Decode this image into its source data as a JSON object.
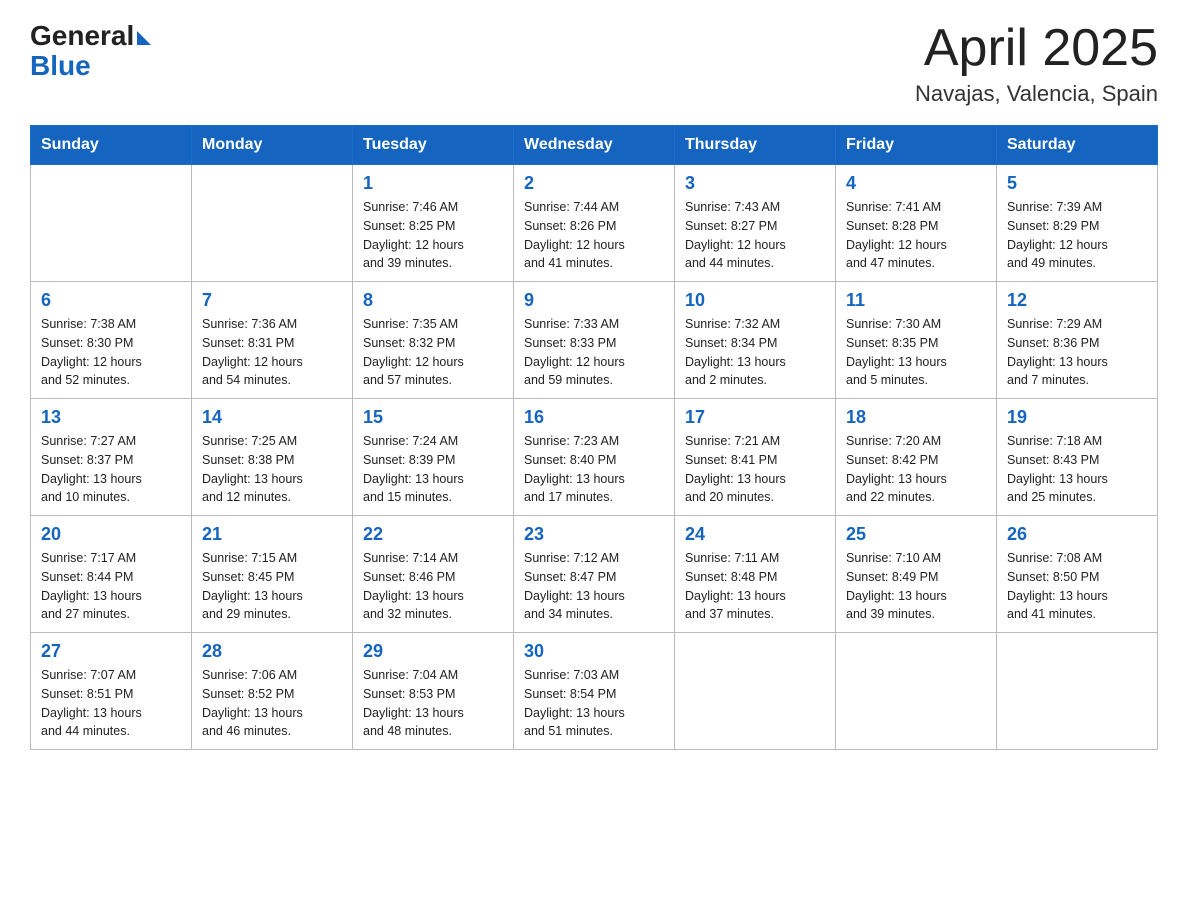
{
  "header": {
    "logo_general": "General",
    "logo_blue": "Blue",
    "title": "April 2025",
    "subtitle": "Navajas, Valencia, Spain"
  },
  "weekdays": [
    "Sunday",
    "Monday",
    "Tuesday",
    "Wednesday",
    "Thursday",
    "Friday",
    "Saturday"
  ],
  "weeks": [
    [
      {
        "day": "",
        "info": ""
      },
      {
        "day": "",
        "info": ""
      },
      {
        "day": "1",
        "info": "Sunrise: 7:46 AM\nSunset: 8:25 PM\nDaylight: 12 hours\nand 39 minutes."
      },
      {
        "day": "2",
        "info": "Sunrise: 7:44 AM\nSunset: 8:26 PM\nDaylight: 12 hours\nand 41 minutes."
      },
      {
        "day": "3",
        "info": "Sunrise: 7:43 AM\nSunset: 8:27 PM\nDaylight: 12 hours\nand 44 minutes."
      },
      {
        "day": "4",
        "info": "Sunrise: 7:41 AM\nSunset: 8:28 PM\nDaylight: 12 hours\nand 47 minutes."
      },
      {
        "day": "5",
        "info": "Sunrise: 7:39 AM\nSunset: 8:29 PM\nDaylight: 12 hours\nand 49 minutes."
      }
    ],
    [
      {
        "day": "6",
        "info": "Sunrise: 7:38 AM\nSunset: 8:30 PM\nDaylight: 12 hours\nand 52 minutes."
      },
      {
        "day": "7",
        "info": "Sunrise: 7:36 AM\nSunset: 8:31 PM\nDaylight: 12 hours\nand 54 minutes."
      },
      {
        "day": "8",
        "info": "Sunrise: 7:35 AM\nSunset: 8:32 PM\nDaylight: 12 hours\nand 57 minutes."
      },
      {
        "day": "9",
        "info": "Sunrise: 7:33 AM\nSunset: 8:33 PM\nDaylight: 12 hours\nand 59 minutes."
      },
      {
        "day": "10",
        "info": "Sunrise: 7:32 AM\nSunset: 8:34 PM\nDaylight: 13 hours\nand 2 minutes."
      },
      {
        "day": "11",
        "info": "Sunrise: 7:30 AM\nSunset: 8:35 PM\nDaylight: 13 hours\nand 5 minutes."
      },
      {
        "day": "12",
        "info": "Sunrise: 7:29 AM\nSunset: 8:36 PM\nDaylight: 13 hours\nand 7 minutes."
      }
    ],
    [
      {
        "day": "13",
        "info": "Sunrise: 7:27 AM\nSunset: 8:37 PM\nDaylight: 13 hours\nand 10 minutes."
      },
      {
        "day": "14",
        "info": "Sunrise: 7:25 AM\nSunset: 8:38 PM\nDaylight: 13 hours\nand 12 minutes."
      },
      {
        "day": "15",
        "info": "Sunrise: 7:24 AM\nSunset: 8:39 PM\nDaylight: 13 hours\nand 15 minutes."
      },
      {
        "day": "16",
        "info": "Sunrise: 7:23 AM\nSunset: 8:40 PM\nDaylight: 13 hours\nand 17 minutes."
      },
      {
        "day": "17",
        "info": "Sunrise: 7:21 AM\nSunset: 8:41 PM\nDaylight: 13 hours\nand 20 minutes."
      },
      {
        "day": "18",
        "info": "Sunrise: 7:20 AM\nSunset: 8:42 PM\nDaylight: 13 hours\nand 22 minutes."
      },
      {
        "day": "19",
        "info": "Sunrise: 7:18 AM\nSunset: 8:43 PM\nDaylight: 13 hours\nand 25 minutes."
      }
    ],
    [
      {
        "day": "20",
        "info": "Sunrise: 7:17 AM\nSunset: 8:44 PM\nDaylight: 13 hours\nand 27 minutes."
      },
      {
        "day": "21",
        "info": "Sunrise: 7:15 AM\nSunset: 8:45 PM\nDaylight: 13 hours\nand 29 minutes."
      },
      {
        "day": "22",
        "info": "Sunrise: 7:14 AM\nSunset: 8:46 PM\nDaylight: 13 hours\nand 32 minutes."
      },
      {
        "day": "23",
        "info": "Sunrise: 7:12 AM\nSunset: 8:47 PM\nDaylight: 13 hours\nand 34 minutes."
      },
      {
        "day": "24",
        "info": "Sunrise: 7:11 AM\nSunset: 8:48 PM\nDaylight: 13 hours\nand 37 minutes."
      },
      {
        "day": "25",
        "info": "Sunrise: 7:10 AM\nSunset: 8:49 PM\nDaylight: 13 hours\nand 39 minutes."
      },
      {
        "day": "26",
        "info": "Sunrise: 7:08 AM\nSunset: 8:50 PM\nDaylight: 13 hours\nand 41 minutes."
      }
    ],
    [
      {
        "day": "27",
        "info": "Sunrise: 7:07 AM\nSunset: 8:51 PM\nDaylight: 13 hours\nand 44 minutes."
      },
      {
        "day": "28",
        "info": "Sunrise: 7:06 AM\nSunset: 8:52 PM\nDaylight: 13 hours\nand 46 minutes."
      },
      {
        "day": "29",
        "info": "Sunrise: 7:04 AM\nSunset: 8:53 PM\nDaylight: 13 hours\nand 48 minutes."
      },
      {
        "day": "30",
        "info": "Sunrise: 7:03 AM\nSunset: 8:54 PM\nDaylight: 13 hours\nand 51 minutes."
      },
      {
        "day": "",
        "info": ""
      },
      {
        "day": "",
        "info": ""
      },
      {
        "day": "",
        "info": ""
      }
    ]
  ]
}
